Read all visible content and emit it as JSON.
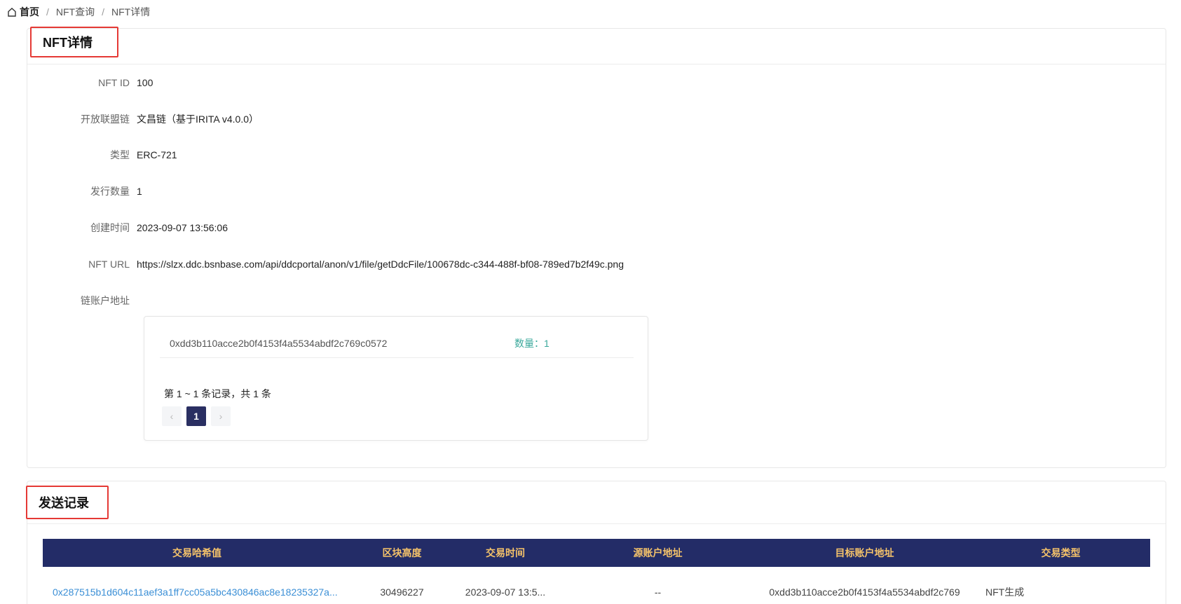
{
  "breadcrumb": {
    "home": "首页",
    "nft_query": "NFT查询",
    "current": "NFT详情"
  },
  "detail": {
    "title": "NFT详情",
    "fields": [
      {
        "label": "NFT ID",
        "value": "100"
      },
      {
        "label": "开放联盟链",
        "value": "文昌链（基于IRITA v4.0.0）"
      },
      {
        "label": "类型",
        "value": "ERC-721"
      },
      {
        "label": "发行数量",
        "value": "1"
      },
      {
        "label": "创建时间",
        "value": "2023-09-07 13:56:06"
      },
      {
        "label": "NFT URL",
        "value": "https://slzx.ddc.bsnbase.com/api/ddcportal/anon/v1/file/getDdcFile/100678dc-c344-488f-bf08-789ed7b2f49c.png"
      },
      {
        "label": "链账户地址",
        "value": ""
      }
    ],
    "owners": [
      {
        "address": "0xdd3b110acce2b0f4153f4a5534abdf2c769c0572",
        "quantity": "数量：1"
      }
    ],
    "pagination": {
      "summary": "第 1 ~ 1 条记录，共 1 条",
      "prev": "‹",
      "current": "1",
      "next": "›"
    }
  },
  "transfers": {
    "title": "发送记录",
    "columns": [
      "交易哈希值",
      "区块高度",
      "交易时间",
      "源账户地址",
      "目标账户地址",
      "交易类型"
    ],
    "rows": [
      {
        "hash": "0x287515b1d604c11aef3a1ff7cc05a5bc430846ac8e18235327a...",
        "block": "30496227",
        "time": "2023-09-07 13:5...",
        "from": "--",
        "to": "0xdd3b110acce2b0f4153f4a5534abdf2c769",
        "type": "NFT生成"
      }
    ]
  },
  "colors": {
    "table_header_bg": "#232c67",
    "table_header_text": "#f5c36a",
    "highlight_border": "#e53935",
    "link": "#3b8fd6",
    "quantity": "#3ba99c"
  }
}
